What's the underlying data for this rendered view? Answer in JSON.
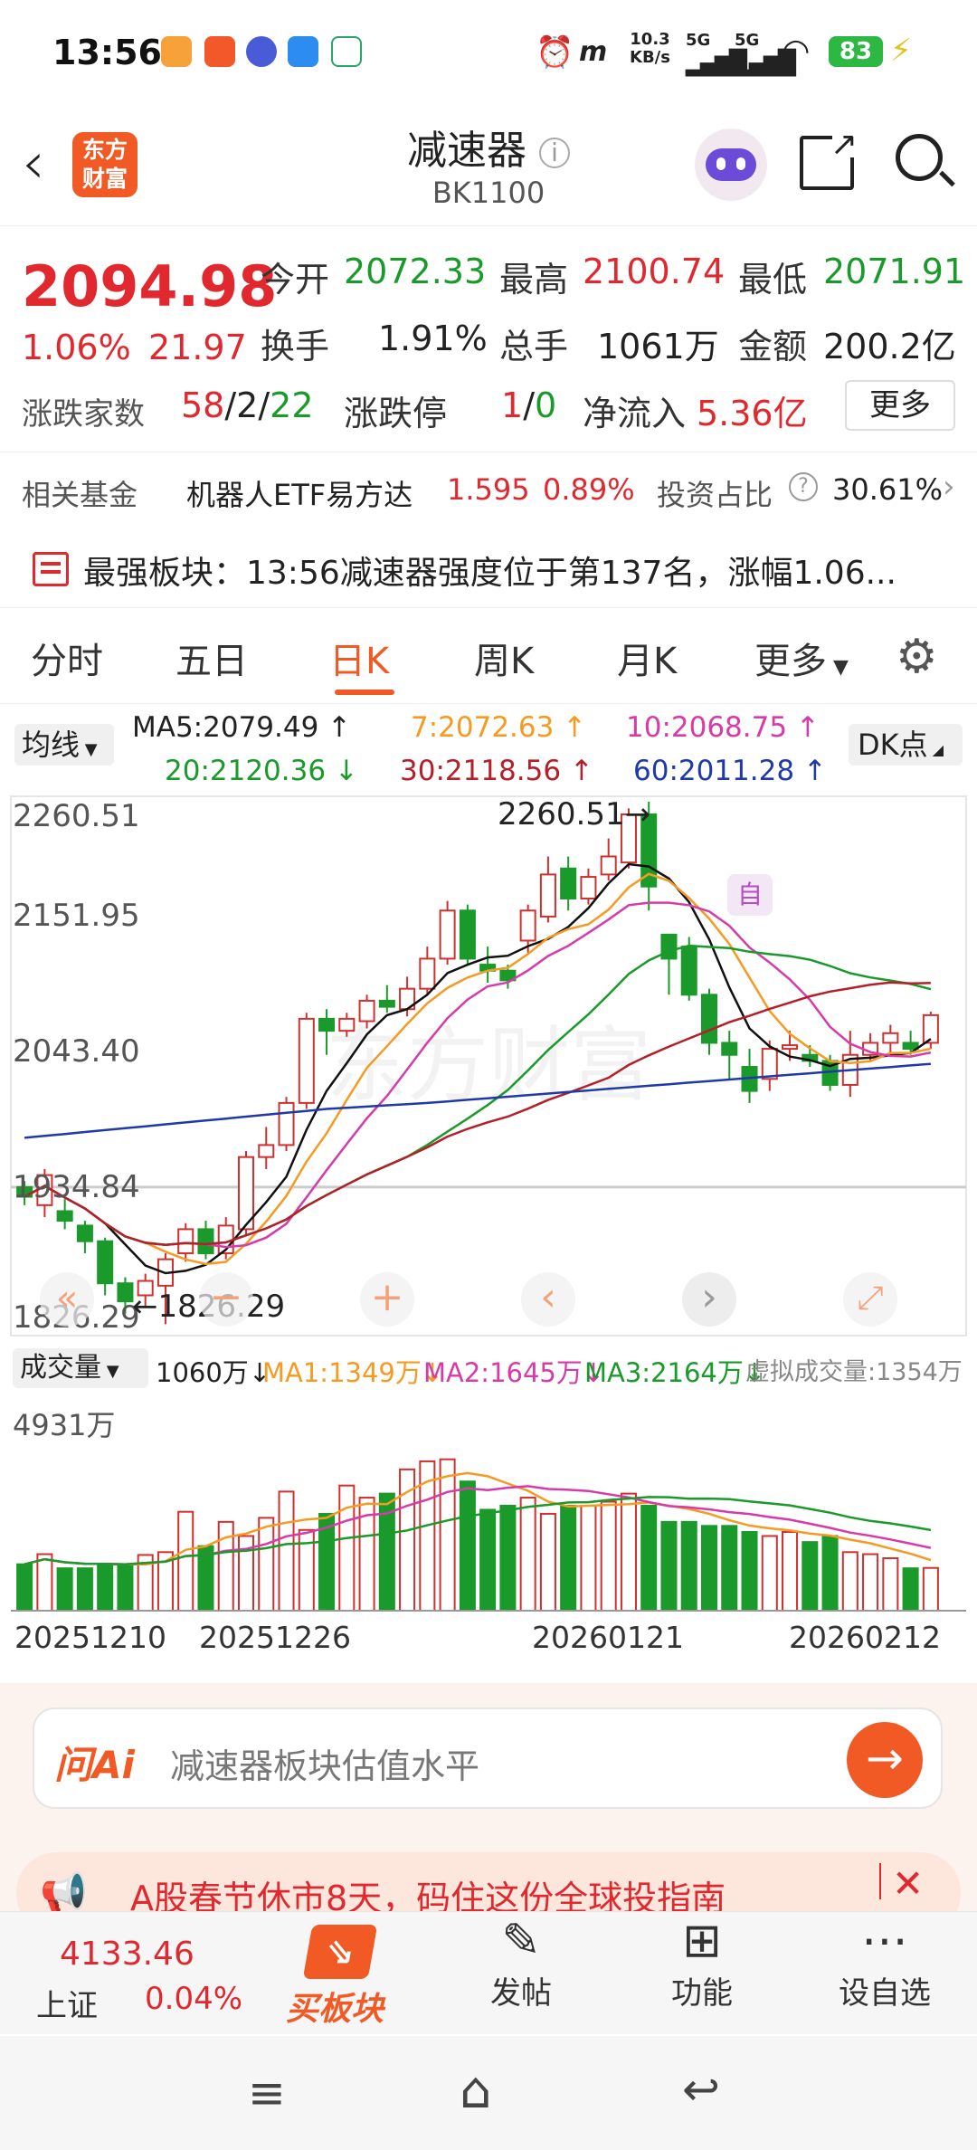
{
  "status": {
    "time": "13:56",
    "net_speed_top": "10.3",
    "net_speed_unit": "KB/s",
    "sig1": "5G",
    "sig2": "5G",
    "battery": "83"
  },
  "nav": {
    "logo_line1": "东方",
    "logo_line2": "财富",
    "title": "减速器",
    "code": "BK1100"
  },
  "quote": {
    "price": "2094.98",
    "pct": "1.06%",
    "chg": "21.97",
    "open_label": "今开",
    "open": "2072.33",
    "high_label": "最高",
    "high": "2100.74",
    "low_label": "最低",
    "low": "2071.91",
    "turnover_label": "换手",
    "turnover": "1.91%",
    "vol_label": "总手",
    "vol": "1061万",
    "amount_label": "金额",
    "amount": "200.2亿",
    "adv_label": "涨跌家数",
    "adv_up": "58",
    "adv_sep1": "/",
    "adv_flat": "2",
    "adv_sep2": "/",
    "adv_down": "22",
    "limit_label": "涨跌停",
    "limit_up": "1",
    "limit_sep": "/",
    "limit_down": "0",
    "inflow_label": "净流入",
    "inflow": "5.36亿",
    "more": "更多"
  },
  "fund": {
    "label": "相关基金",
    "name": "机器人ETF易方达",
    "price": "1.595",
    "pct": "0.89%",
    "ratio_label": "投资占比",
    "ratio": "30.61%"
  },
  "strong": {
    "text": "最强板块：13:56减速器强度位于第137名，涨幅1.06..."
  },
  "tabs": [
    "分时",
    "五日",
    "日K",
    "周K",
    "月K",
    "更多"
  ],
  "ma": {
    "selector": "均线",
    "ma5": "MA5:2079.49",
    "ma7": "7:2072.63",
    "ma10": "10:2068.75",
    "ma20": "20:2120.36",
    "ma30": "30:2118.56",
    "ma60": "60:2011.28",
    "dk": "DK点"
  },
  "chart_data": {
    "type": "candlestick",
    "y_ticks": [
      "2260.51",
      "2151.95",
      "2043.40",
      "1934.84",
      "1826.29"
    ],
    "ylim": [
      1826.29,
      2260.51
    ],
    "max_label": "2260.51",
    "min_label": "1826.29",
    "self_badge": "自",
    "x_labels": [
      "20251210",
      "20251226",
      "20260121",
      "20260212"
    ],
    "candles": [
      {
        "o": 1940,
        "c": 1932,
        "h": 1945,
        "l": 1925
      },
      {
        "o": 1925,
        "c": 1950,
        "h": 1955,
        "l": 1915
      },
      {
        "o": 1920,
        "c": 1912,
        "h": 1930,
        "l": 1905
      },
      {
        "o": 1908,
        "c": 1895,
        "h": 1912,
        "l": 1885
      },
      {
        "o": 1895,
        "c": 1860,
        "h": 1898,
        "l": 1850
      },
      {
        "o": 1860,
        "c": 1845,
        "h": 1865,
        "l": 1835
      },
      {
        "o": 1850,
        "c": 1862,
        "h": 1868,
        "l": 1840
      },
      {
        "o": 1858,
        "c": 1880,
        "h": 1885,
        "l": 1826
      },
      {
        "o": 1885,
        "c": 1905,
        "h": 1910,
        "l": 1878
      },
      {
        "o": 1905,
        "c": 1885,
        "h": 1912,
        "l": 1880
      },
      {
        "o": 1885,
        "c": 1908,
        "h": 1915,
        "l": 1880
      },
      {
        "o": 1905,
        "c": 1965,
        "h": 1970,
        "l": 1900
      },
      {
        "o": 1965,
        "c": 1975,
        "h": 1990,
        "l": 1955
      },
      {
        "o": 1975,
        "c": 2010,
        "h": 2015,
        "l": 1970
      },
      {
        "o": 2010,
        "c": 2080,
        "h": 2085,
        "l": 2005
      },
      {
        "o": 2080,
        "c": 2070,
        "h": 2088,
        "l": 2050
      },
      {
        "o": 2070,
        "c": 2080,
        "h": 2085,
        "l": 2065
      },
      {
        "o": 2078,
        "c": 2095,
        "h": 2100,
        "l": 2072
      },
      {
        "o": 2095,
        "c": 2090,
        "h": 2108,
        "l": 2085
      },
      {
        "o": 2088,
        "c": 2105,
        "h": 2115,
        "l": 2082
      },
      {
        "o": 2105,
        "c": 2130,
        "h": 2140,
        "l": 2100
      },
      {
        "o": 2130,
        "c": 2170,
        "h": 2178,
        "l": 2125
      },
      {
        "o": 2170,
        "c": 2130,
        "h": 2175,
        "l": 2125
      },
      {
        "o": 2125,
        "c": 2120,
        "h": 2140,
        "l": 2110
      },
      {
        "o": 2120,
        "c": 2112,
        "h": 2125,
        "l": 2105
      },
      {
        "o": 2145,
        "c": 2170,
        "h": 2175,
        "l": 2135
      },
      {
        "o": 2165,
        "c": 2200,
        "h": 2215,
        "l": 2160
      },
      {
        "o": 2205,
        "c": 2180,
        "h": 2215,
        "l": 2170
      },
      {
        "o": 2180,
        "c": 2198,
        "h": 2205,
        "l": 2175
      },
      {
        "o": 2200,
        "c": 2215,
        "h": 2230,
        "l": 2195
      },
      {
        "o": 2210,
        "c": 2250,
        "h": 2255,
        "l": 2205
      },
      {
        "o": 2250,
        "c": 2190,
        "h": 2260.51,
        "l": 2170
      },
      {
        "o": 2150,
        "c": 2130,
        "h": 2150,
        "l": 2100
      },
      {
        "o": 2140,
        "c": 2100,
        "h": 2148,
        "l": 2095
      },
      {
        "o": 2100,
        "c": 2060,
        "h": 2105,
        "l": 2050
      },
      {
        "o": 2060,
        "c": 2050,
        "h": 2070,
        "l": 2030
      },
      {
        "o": 2040,
        "c": 2020,
        "h": 2055,
        "l": 2010
      },
      {
        "o": 2030,
        "c": 2055,
        "h": 2062,
        "l": 2020
      },
      {
        "o": 2055,
        "c": 2058,
        "h": 2070,
        "l": 2045
      },
      {
        "o": 2050,
        "c": 2045,
        "h": 2058,
        "l": 2040
      },
      {
        "o": 2045,
        "c": 2025,
        "h": 2050,
        "l": 2020
      },
      {
        "o": 2025,
        "c": 2050,
        "h": 2070,
        "l": 2015
      },
      {
        "o": 2050,
        "c": 2060,
        "h": 2068,
        "l": 2045
      },
      {
        "o": 2060,
        "c": 2068,
        "h": 2075,
        "l": 2050
      },
      {
        "o": 2060,
        "c": 2055,
        "h": 2070,
        "l": 2050
      },
      {
        "o": 2060,
        "c": 2083,
        "h": 2086,
        "l": 2055
      }
    ],
    "vol_top_label": "4931万",
    "volumes": [
      1150,
      1400,
      1050,
      1050,
      1150,
      1100,
      1380,
      1450,
      2450,
      1600,
      2200,
      1850,
      2300,
      2950,
      2000,
      2400,
      3100,
      2800,
      2900,
      3500,
      3700,
      3750,
      3200,
      2500,
      2600,
      2800,
      2400,
      2600,
      2600,
      2700,
      2900,
      2600,
      2200,
      2200,
      2100,
      2100,
      1950,
      1850,
      1950,
      1700,
      1850,
      1450,
      1400,
      1300,
      1050,
      1060
    ]
  },
  "volbar": {
    "selector": "成交量",
    "vol": "1060万",
    "ma1": "MA1:1349万",
    "ma2": "MA2:1645万",
    "ma3": "MA3:2164万",
    "virtual": "虚拟成交量:1354万"
  },
  "ask": {
    "brand": "问Ai",
    "placeholder": "减速器板块估值水平"
  },
  "banner": {
    "text": "A股春节休市8天，码住这份全球投指南"
  },
  "bottom": {
    "index_val": "4133.46",
    "index_name": "上证",
    "index_pct": "0.04%",
    "buy": "买板块",
    "post": "发帖",
    "func": "功能",
    "fav": "设自选"
  }
}
